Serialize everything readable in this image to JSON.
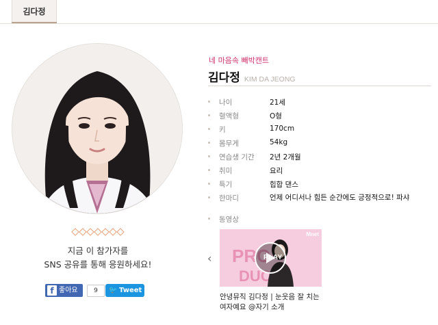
{
  "tab": {
    "label": "김다정"
  },
  "profile": {
    "tagline": "네 마음속 빼박캔트",
    "name": "김다정",
    "name_en": "KIM DA JEONG",
    "fields": [
      {
        "label": "나이",
        "value": "21세"
      },
      {
        "label": "혈액형",
        "value": "O형"
      },
      {
        "label": "키",
        "value": "170cm"
      },
      {
        "label": "몸무게",
        "value": "54kg"
      },
      {
        "label": "연습생 기간",
        "value": "2년 2개월"
      },
      {
        "label": "취미",
        "value": "요리"
      },
      {
        "label": "특기",
        "value": "힙합 댄스"
      },
      {
        "label": "한마디",
        "value": "언제 어디서나 힘든 순간에도 긍정적으로! 파샤"
      }
    ],
    "video_label": "동영상"
  },
  "share": {
    "line1": "지금 이 참가자를",
    "line2": "SNS 공유를 통해 응원하세요!",
    "fb_label": "좋아요",
    "fb_count": "9",
    "tweet_label": "Tweet"
  },
  "video": {
    "play_label": "PLAY",
    "mnet_label": "Mnet",
    "caption": "안녕뮤직 김다정 | 눈웃음 잘 치는 여자예요 @자기 소개"
  },
  "colors": {
    "accent_pink": "#d0336c",
    "facebook": "#4267b2",
    "twitter": "#1b95e0",
    "deco": "#e8a27a"
  }
}
